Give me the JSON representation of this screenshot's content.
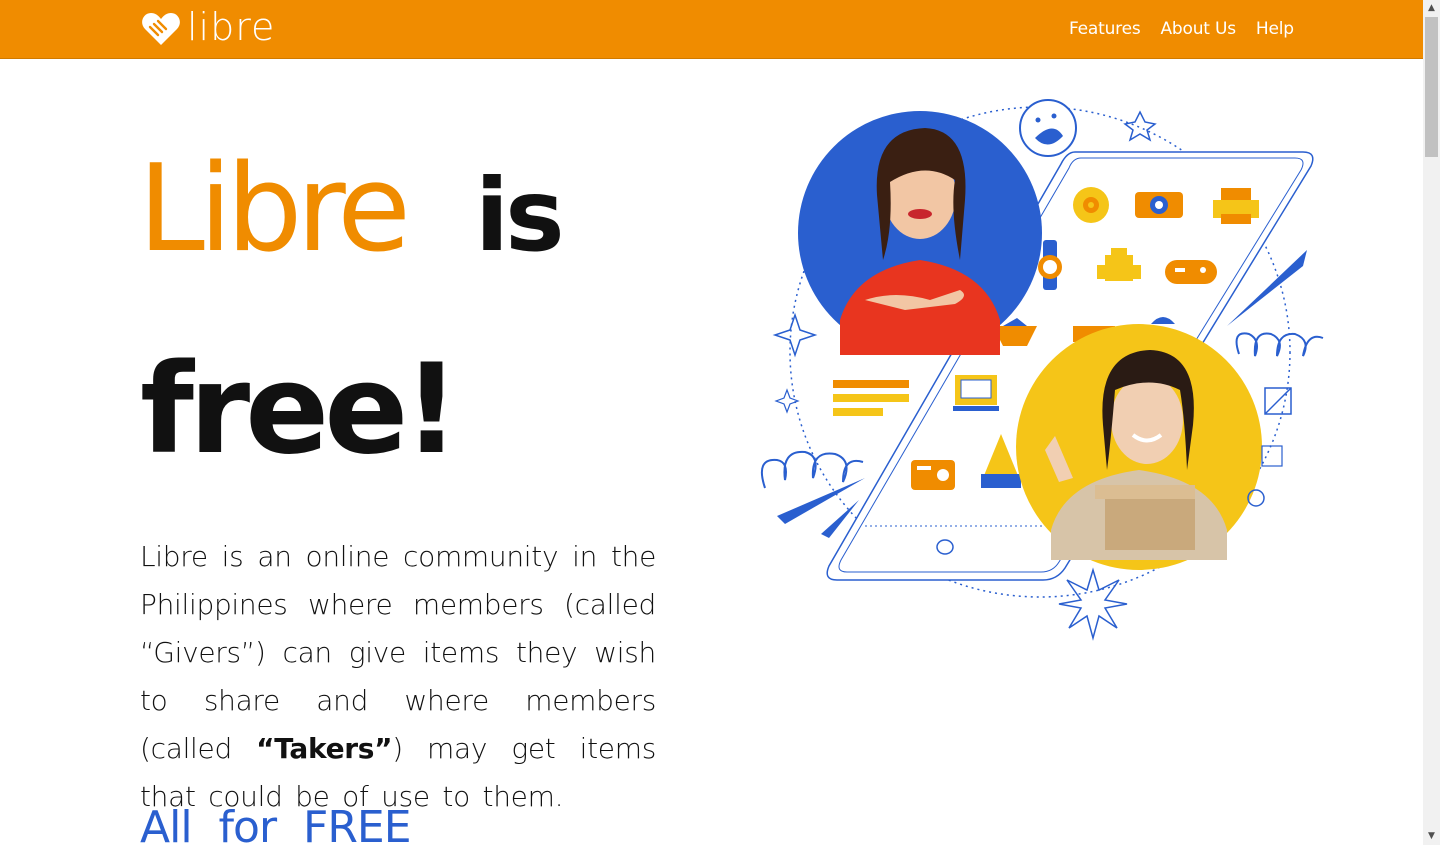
{
  "header": {
    "brand": "libre",
    "nav": [
      "Features",
      "About Us",
      "Help"
    ]
  },
  "hero": {
    "headline_word_1": "Libre",
    "headline_word_2": "is",
    "headline_line_2": "free!",
    "description_before": "Libre is an online community in the Philippines where members (called “Givers”) can give items they wish to share and where members (called ",
    "description_bold": "“Takers”",
    "description_after": ") may get items that could be of use to them.",
    "tagline": "All for FREE"
  },
  "colors": {
    "brand_orange": "#f08c00",
    "accent_blue": "#2a5fcf",
    "yellow": "#f5c518"
  }
}
